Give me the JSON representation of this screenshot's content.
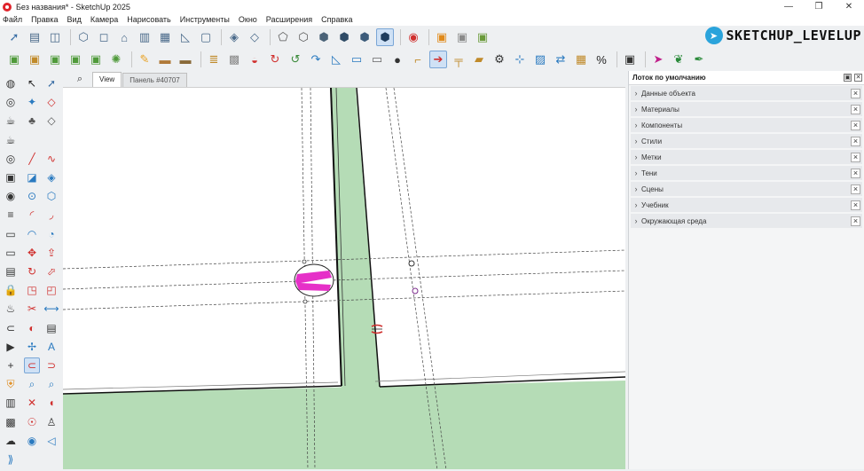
{
  "window": {
    "title": "Без названия* - SketchUp 2025",
    "minimize": "—",
    "maximize": "❐",
    "close": "✕"
  },
  "menu": [
    "Файл",
    "Правка",
    "Вид",
    "Камера",
    "Нарисовать",
    "Инструменты",
    "Окно",
    "Расширения",
    "Справка"
  ],
  "brand": {
    "text": "SKETCHUP_LEVELUP",
    "icon": "telegram-icon"
  },
  "tabs": {
    "search_icon": "⌕",
    "items": [
      {
        "label": "View",
        "active": true
      },
      {
        "label": "Панель #40707",
        "active": false
      }
    ]
  },
  "tray": {
    "title": "Лоток по умолчанию",
    "pin": "▣",
    "close": "✕",
    "panels": [
      {
        "label": "Данные объекта"
      },
      {
        "label": "Материалы"
      },
      {
        "label": "Компоненты"
      },
      {
        "label": "Стили"
      },
      {
        "label": "Метки"
      },
      {
        "label": "Тени"
      },
      {
        "label": "Сцены"
      },
      {
        "label": "Учебник"
      },
      {
        "label": "Окружающая среда"
      }
    ]
  },
  "toolbar_row1": [
    {
      "icon": "select-arrow-icon",
      "glyph": "➚",
      "color": "#3a6ea5"
    },
    {
      "icon": "document-icon",
      "glyph": "▤",
      "color": "#4a6a8a"
    },
    {
      "icon": "split-panel-icon",
      "glyph": "◫",
      "color": "#4a6a8a"
    },
    {
      "sep": true
    },
    {
      "icon": "iso-view-icon",
      "glyph": "⬡",
      "color": "#4a6a8a"
    },
    {
      "icon": "top-view-icon",
      "glyph": "◻",
      "color": "#4a6a8a"
    },
    {
      "icon": "front-view-icon",
      "glyph": "⌂",
      "color": "#4a6a8a"
    },
    {
      "icon": "right-view-icon",
      "glyph": "▥",
      "color": "#4a6a8a"
    },
    {
      "icon": "back-view-icon",
      "glyph": "▦",
      "color": "#4a6a8a"
    },
    {
      "icon": "left-view-icon",
      "glyph": "◺",
      "color": "#4a6a8a"
    },
    {
      "icon": "bottom-view-icon",
      "glyph": "▢",
      "color": "#4a6a8a"
    },
    {
      "sep": true
    },
    {
      "icon": "xray-icon",
      "glyph": "◈",
      "color": "#4a6a8a"
    },
    {
      "icon": "back-edges-icon",
      "glyph": "◇",
      "color": "#4a6a8a"
    },
    {
      "sep": true
    },
    {
      "icon": "wireframe-icon",
      "glyph": "⬠",
      "color": "#555"
    },
    {
      "icon": "hidden-line-icon",
      "glyph": "⬡",
      "color": "#555"
    },
    {
      "icon": "shaded-icon",
      "glyph": "⬢",
      "color": "#4b6378"
    },
    {
      "icon": "shaded-textures-icon",
      "glyph": "⬢",
      "color": "#2f4b66"
    },
    {
      "icon": "monochrome-icon",
      "glyph": "⬢",
      "color": "#3c5b7a"
    },
    {
      "icon": "monochrome-active-icon",
      "glyph": "⬢",
      "color": "#1f3c5c",
      "active": true
    },
    {
      "sep": true
    },
    {
      "icon": "style-icon",
      "glyph": "◉",
      "color": "#d0302e"
    },
    {
      "sep": true
    },
    {
      "icon": "component-icon",
      "glyph": "▣",
      "color": "#e08a1a"
    },
    {
      "icon": "group-icon",
      "glyph": "▣",
      "color": "#8a8a8a"
    },
    {
      "icon": "solid-icon",
      "glyph": "▣",
      "color": "#6a9a3a"
    }
  ],
  "toolbar_row2": [
    {
      "icon": "green-box-icon",
      "glyph": "▣",
      "color": "#4f9a3a"
    },
    {
      "icon": "box-plus-icon",
      "glyph": "▣",
      "color": "#c08a2a"
    },
    {
      "icon": "green-cube-icon",
      "glyph": "▣",
      "color": "#4f9a3a"
    },
    {
      "icon": "box-arrows-icon",
      "glyph": "▣",
      "color": "#4f9a3a"
    },
    {
      "icon": "box-star-icon",
      "glyph": "▣",
      "color": "#4f9a3a"
    },
    {
      "icon": "gear-green-icon",
      "glyph": "✺",
      "color": "#4f9a3a"
    },
    {
      "sep": true
    },
    {
      "icon": "pencil-icon",
      "glyph": "✎",
      "color": "#e8a020"
    },
    {
      "icon": "plank-icon",
      "glyph": "▬",
      "color": "#b07a3a"
    },
    {
      "icon": "beam-icon",
      "glyph": "▬",
      "color": "#8a6a3a"
    },
    {
      "sep": true
    },
    {
      "icon": "stack-icon",
      "glyph": "≣",
      "color": "#c08a2a"
    },
    {
      "icon": "gray-box-icon",
      "glyph": "▩",
      "color": "#888"
    },
    {
      "icon": "magnet-icon",
      "glyph": "◒",
      "color": "#d0302e"
    },
    {
      "icon": "curve-icon",
      "glyph": "↻",
      "color": "#d0302e"
    },
    {
      "icon": "follow-icon",
      "glyph": "↺",
      "color": "#3a8a3a"
    },
    {
      "icon": "rotate-blue-icon",
      "glyph": "↷",
      "color": "#2a7ac0"
    },
    {
      "icon": "triangle-icon",
      "glyph": "◺",
      "color": "#2a7ac0"
    },
    {
      "icon": "slab-icon",
      "glyph": "▭",
      "color": "#2a7ac0"
    },
    {
      "icon": "plate-icon",
      "glyph": "▭",
      "color": "#666"
    },
    {
      "icon": "knob-icon",
      "glyph": "●",
      "color": "#333"
    },
    {
      "icon": "bracket-icon",
      "glyph": "⌐",
      "color": "#c08a2a"
    },
    {
      "icon": "drill-icon",
      "glyph": "➔",
      "color": "#d0302e",
      "active": true
    },
    {
      "icon": "pipe-icon",
      "glyph": "╤",
      "color": "#c08a2a"
    },
    {
      "icon": "board-icon",
      "glyph": "▰",
      "color": "#c08a2a"
    },
    {
      "icon": "cog-icon",
      "glyph": "⚙",
      "color": "#333"
    },
    {
      "icon": "measure-icon",
      "glyph": "⊹",
      "color": "#2a7ac0"
    },
    {
      "icon": "frame-icon",
      "glyph": "▨",
      "color": "#2a7ac0"
    },
    {
      "icon": "swap-icon",
      "glyph": "⇄",
      "color": "#2a7ac0"
    },
    {
      "icon": "crate-icon",
      "glyph": "▦",
      "color": "#c08a2a"
    },
    {
      "icon": "percent-icon",
      "glyph": "%",
      "color": "#222"
    },
    {
      "sep": true
    },
    {
      "icon": "box-label-icon",
      "glyph": "▣",
      "color": "#333"
    },
    {
      "sep": true
    },
    {
      "icon": "cursor-magenta-icon",
      "glyph": "➤",
      "color": "#c0208a"
    },
    {
      "icon": "plant-icon",
      "glyph": "❦",
      "color": "#2a8a3a"
    },
    {
      "icon": "paint-icon",
      "glyph": "✒",
      "color": "#2a8a3a"
    }
  ],
  "left_tools": [
    {
      "icon": "select-icon",
      "glyph": "↖",
      "color": "#222",
      "col": 0,
      "row": 0
    },
    {
      "icon": "lasso-icon",
      "glyph": "➚",
      "color": "#3a6ea5",
      "col": 1,
      "row": 0
    },
    {
      "icon": "paint-bucket-icon",
      "glyph": "✦",
      "color": "#2a7ac0",
      "col": 0,
      "row": 1
    },
    {
      "icon": "eraser-icon",
      "glyph": "◇",
      "color": "#d0302e",
      "col": 1,
      "row": 1
    },
    {
      "icon": "tag-icon",
      "glyph": "♣",
      "color": "#555",
      "col": 0,
      "row": 2
    },
    {
      "icon": "diamond-icon",
      "glyph": "◇",
      "color": "#555",
      "col": 1,
      "row": 2
    },
    {
      "icon": "line-icon",
      "glyph": "╱",
      "color": "#d0302e",
      "col": 0,
      "row": 4
    },
    {
      "icon": "freehand-icon",
      "glyph": "∿",
      "color": "#d0302e",
      "col": 1,
      "row": 4
    },
    {
      "icon": "rectangle-icon",
      "glyph": "◪",
      "color": "#2a7ac0",
      "col": 0,
      "row": 5
    },
    {
      "icon": "rotated-rect-icon",
      "glyph": "◈",
      "color": "#2a7ac0",
      "col": 1,
      "row": 5
    },
    {
      "icon": "circle-icon",
      "glyph": "⊙",
      "color": "#2a7ac0",
      "col": 0,
      "row": 6
    },
    {
      "icon": "polygon-icon",
      "glyph": "⬡",
      "color": "#2a7ac0",
      "col": 1,
      "row": 6
    },
    {
      "icon": "arc-icon",
      "glyph": "◜",
      "color": "#d0302e",
      "col": 0,
      "row": 7
    },
    {
      "icon": "arc2-icon",
      "glyph": "◞",
      "color": "#d0302e",
      "col": 1,
      "row": 7
    },
    {
      "icon": "arc3-icon",
      "glyph": "◠",
      "color": "#2a7ac0",
      "col": 0,
      "row": 8
    },
    {
      "icon": "pie-icon",
      "glyph": "◔",
      "color": "#2a7ac0",
      "col": 1,
      "row": 8
    },
    {
      "icon": "move-icon",
      "glyph": "✥",
      "color": "#d0302e",
      "col": 0,
      "row": 9
    },
    {
      "icon": "pushpull-icon",
      "glyph": "⇪",
      "color": "#d0302e",
      "col": 1,
      "row": 9
    },
    {
      "icon": "rotate-icon",
      "glyph": "↻",
      "color": "#d0302e",
      "col": 0,
      "row": 10
    },
    {
      "icon": "followme-icon",
      "glyph": "⬀",
      "color": "#d0302e",
      "col": 1,
      "row": 10
    },
    {
      "icon": "scale-icon",
      "glyph": "◳",
      "color": "#d0302e",
      "col": 0,
      "row": 11
    },
    {
      "icon": "offset-icon",
      "glyph": "◰",
      "color": "#d0302e",
      "col": 1,
      "row": 11
    },
    {
      "icon": "tape-icon",
      "glyph": "✂",
      "color": "#d0302e",
      "col": 0,
      "row": 12
    },
    {
      "icon": "dimension-icon",
      "glyph": "⟷",
      "color": "#2a7ac0",
      "col": 1,
      "row": 12
    },
    {
      "icon": "protractor-icon",
      "glyph": "◐",
      "color": "#d0302e",
      "col": 0,
      "row": 13
    },
    {
      "icon": "text-icon",
      "glyph": "▤",
      "color": "#333",
      "col": 1,
      "row": 13
    },
    {
      "icon": "axes-icon",
      "glyph": "✢",
      "color": "#2a7ac0",
      "col": 0,
      "row": 14
    },
    {
      "icon": "3dtext-icon",
      "glyph": "A",
      "color": "#2a7ac0",
      "col": 1,
      "row": 14
    },
    {
      "icon": "section-icon",
      "glyph": "⊂",
      "color": "#d0302e",
      "col": 0,
      "row": 15,
      "active": true
    },
    {
      "icon": "section-fill-icon",
      "glyph": "⊃",
      "color": "#d0302e",
      "col": 1,
      "row": 15
    },
    {
      "icon": "zoom-icon",
      "glyph": "⌕",
      "color": "#2a7ac0",
      "col": 0,
      "row": 16
    },
    {
      "icon": "zoom-window-icon",
      "glyph": "⌕",
      "color": "#2a7ac0",
      "col": 1,
      "row": 16
    },
    {
      "icon": "zoom-extents-icon",
      "glyph": "✕",
      "color": "#d0302e",
      "col": 0,
      "row": 17
    },
    {
      "icon": "previous-icon",
      "glyph": "◖",
      "color": "#d0302e",
      "col": 1,
      "row": 17
    },
    {
      "icon": "position-camera-icon",
      "glyph": "☉",
      "color": "#d0302e",
      "col": 0,
      "row": 18
    },
    {
      "icon": "walk-icon",
      "glyph": "♙",
      "color": "#333",
      "col": 1,
      "row": 18
    },
    {
      "icon": "look-around-icon",
      "glyph": "◉",
      "color": "#2a7ac0",
      "col": 0,
      "row": 19
    },
    {
      "icon": "sound-icon",
      "glyph": "◁",
      "color": "#2a7ac0",
      "col": 1,
      "row": 19
    }
  ],
  "left_extra": [
    {
      "icon": "warehouse-icon",
      "glyph": "◍",
      "color": "#333",
      "row": 0
    },
    {
      "icon": "trimble-icon",
      "glyph": "◎",
      "color": "#333",
      "row": 1
    },
    {
      "icon": "teapot-icon",
      "glyph": "☕",
      "color": "#333",
      "row": 2
    },
    {
      "icon": "teapot2-icon",
      "glyph": "☕",
      "color": "#333",
      "row": 3
    },
    {
      "icon": "spiral-icon",
      "glyph": "◎",
      "color": "#333",
      "row": 4
    },
    {
      "icon": "image-icon",
      "glyph": "▣",
      "color": "#333",
      "row": 5
    },
    {
      "icon": "camera-round-icon",
      "glyph": "◉",
      "color": "#333",
      "row": 6
    },
    {
      "icon": "layers-icon",
      "glyph": "≡",
      "color": "#333",
      "row": 7
    },
    {
      "icon": "scene-icon",
      "glyph": "▭",
      "color": "#333",
      "row": 8
    },
    {
      "icon": "display-icon",
      "glyph": "▭",
      "color": "#333",
      "row": 9
    },
    {
      "icon": "print-icon",
      "glyph": "▤",
      "color": "#333",
      "row": 10
    },
    {
      "icon": "lock-icon",
      "glyph": "🔒",
      "color": "#333",
      "row": 11
    },
    {
      "icon": "bucket-icon",
      "glyph": "♨",
      "color": "#333",
      "row": 12
    },
    {
      "icon": "section-main-icon",
      "glyph": "⊂",
      "color": "#333",
      "row": 13
    },
    {
      "icon": "video-icon",
      "glyph": "▶",
      "color": "#333",
      "row": 14
    },
    {
      "icon": "add-icon",
      "glyph": "+",
      "color": "#333",
      "row": 15
    },
    {
      "icon": "shield-icon",
      "glyph": "⛨",
      "color": "#e08a1a",
      "row": 16
    },
    {
      "icon": "building-icon",
      "glyph": "▥",
      "color": "#333",
      "row": 17
    },
    {
      "icon": "checker-icon",
      "glyph": "▩",
      "color": "#333",
      "row": 18
    },
    {
      "icon": "cloud-icon",
      "glyph": "☁",
      "color": "#333",
      "row": 19
    },
    {
      "icon": "chevrons-icon",
      "glyph": "⟫",
      "color": "#2a7ac0",
      "row": 20
    }
  ],
  "colors": {
    "green": "#b5dcb6",
    "magenta": "#e630c8",
    "accent": "#2aa3db"
  }
}
